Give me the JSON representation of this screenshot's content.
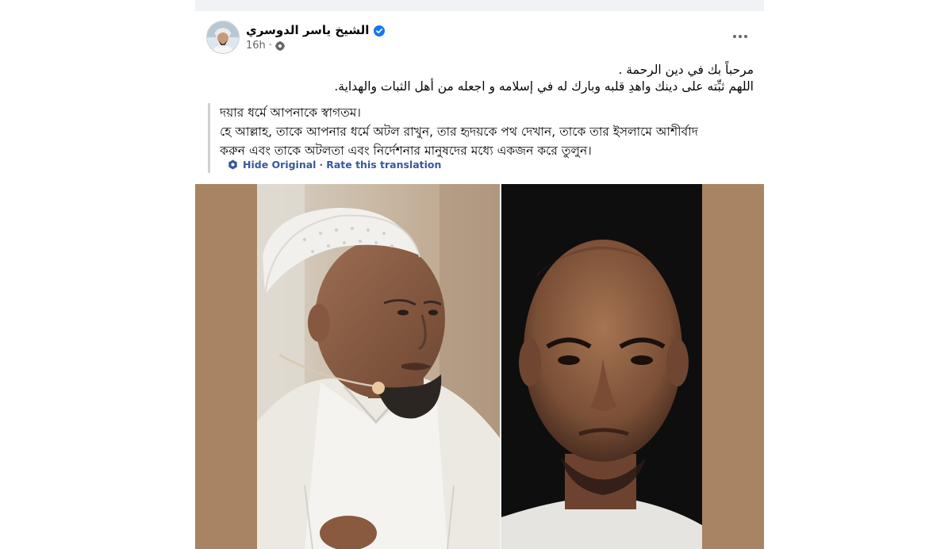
{
  "post": {
    "author_name": "الشيخ ياسر الدوسري",
    "time": "16h",
    "meta_separator": "·",
    "original_lines": [
      "مرحباً بك في دين الرحمة .",
      "اللهم ثبِّته على دينك واهدِ قلبه وبارك له في إسلامه و اجعله من أهل الثبات والهداية."
    ],
    "translation_lines": [
      "দয়ার ধর্মে আপনাকে স্বাগতম।",
      "হে আল্লাহ, তাকে আপনার ধর্মে অটল রাখুন, তার হৃদয়কে পথ দেখান, তাকে তার ইসলামে আশীর্বাদ",
      "করুন এবং তাকে অটলতা এবং নির্দেশনার মানুষদের মধ্যে একজন করে তুলুন।"
    ],
    "hide_original_label": "Hide Original",
    "rate_translation_label": "Rate this translation",
    "action_separator": "·"
  },
  "icons": {
    "verified": "verified-badge-icon",
    "audience": "globe-icon",
    "more": "more-options-icon",
    "translate": "translate-icon"
  },
  "colors": {
    "link": "#385898",
    "verified": "#1877f2",
    "media_bg": "#a88462"
  }
}
